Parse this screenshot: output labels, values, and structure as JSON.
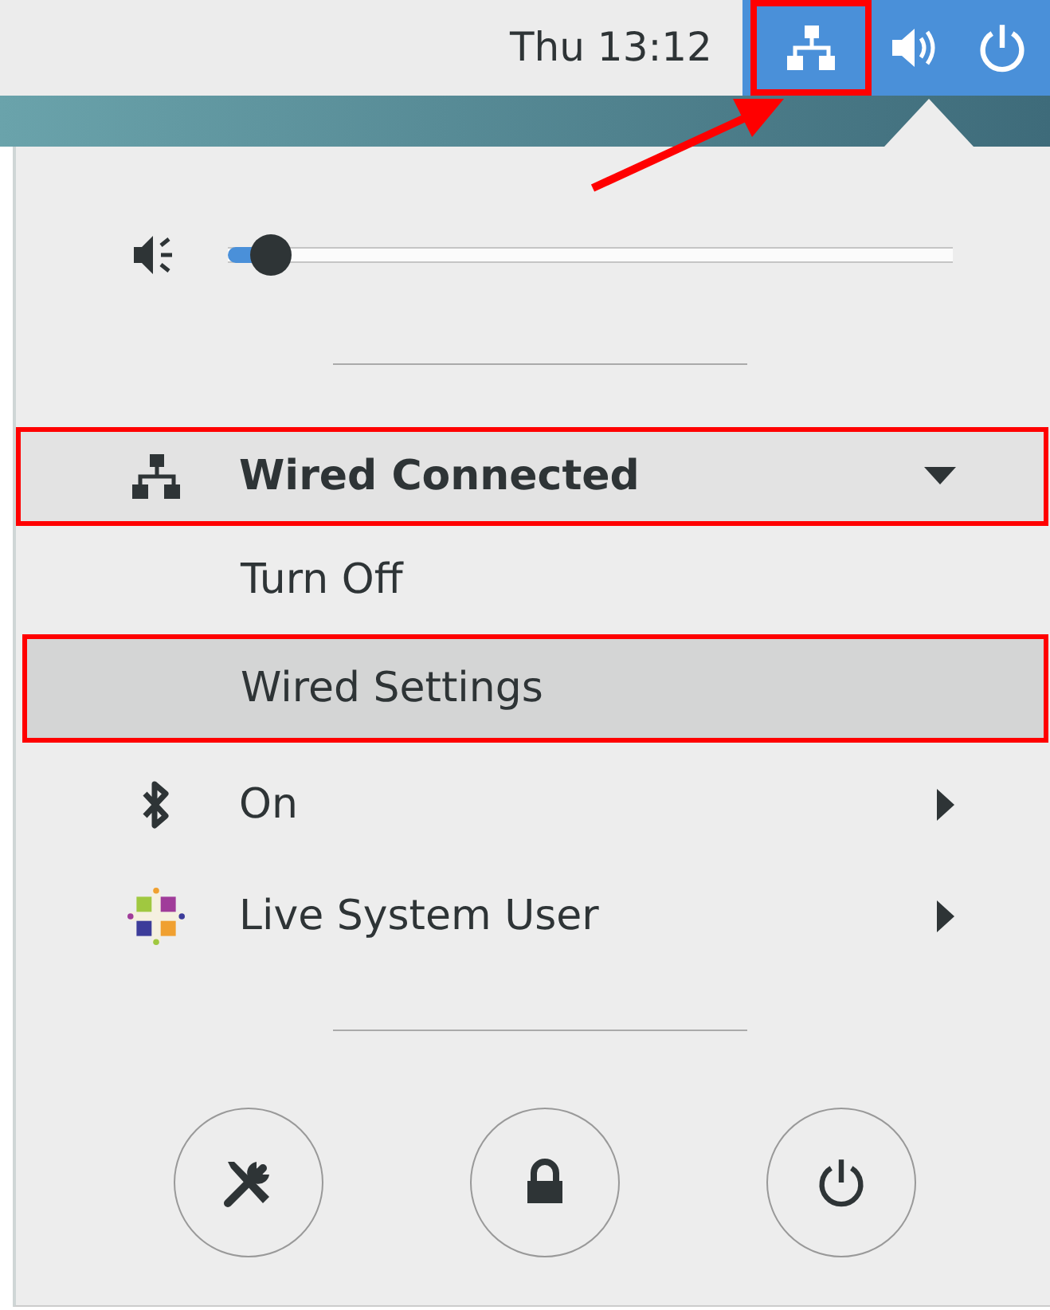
{
  "top_bar": {
    "clock": "Thu 13:12",
    "tray": [
      {
        "kind": "network",
        "highlighted": true
      },
      {
        "kind": "volume",
        "highlighted": false
      },
      {
        "kind": "power",
        "highlighted": false
      }
    ]
  },
  "menu": {
    "volume": {
      "level": 0.06
    },
    "sections": [
      {
        "kind": "network",
        "label": "Wired Connected",
        "expanded": true,
        "highlighted": true
      },
      {
        "kind": "subitem",
        "label": "Turn Off",
        "selected": false,
        "highlighted": false
      },
      {
        "kind": "subitem",
        "label": "Wired Settings",
        "selected": true,
        "highlighted": true
      },
      {
        "kind": "bluetooth",
        "label": "On",
        "expanded": false,
        "highlighted": false
      },
      {
        "kind": "user",
        "label": "Live System User",
        "expanded": false,
        "highlighted": false
      }
    ],
    "action_buttons": [
      {
        "kind": "settings"
      },
      {
        "kind": "lock"
      },
      {
        "kind": "power"
      }
    ]
  }
}
